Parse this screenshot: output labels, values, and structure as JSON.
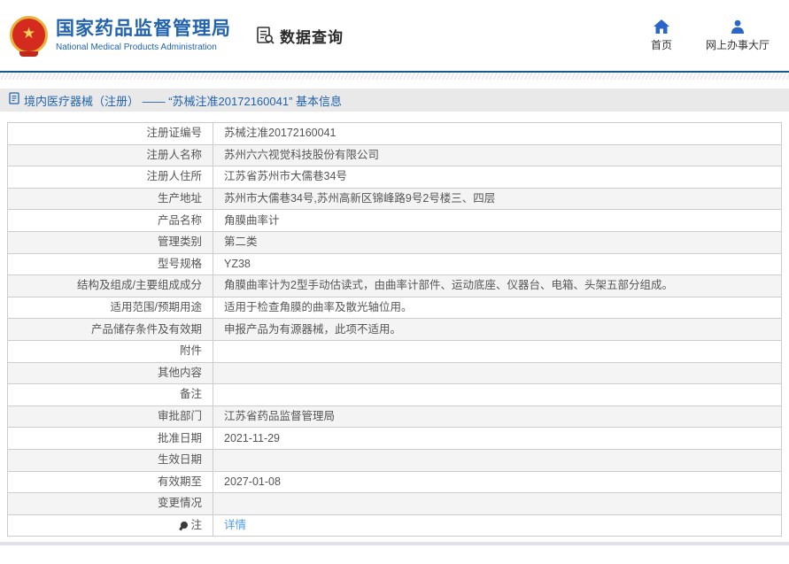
{
  "header": {
    "logo_title": "国家药品监督管理局",
    "logo_subtitle": "National Medical Products Administration",
    "section_label": "数据查询",
    "nav": [
      {
        "label": "首页"
      },
      {
        "label": "网上办事大厅"
      }
    ]
  },
  "breadcrumb": {
    "text": "境内医疗器械（注册） —— “苏械注准20172160041” 基本信息"
  },
  "table": {
    "rows": [
      {
        "label": "注册证编号",
        "value": "苏械注准20172160041"
      },
      {
        "label": "注册人名称",
        "value": "苏州六六视觉科技股份有限公司"
      },
      {
        "label": "注册人住所",
        "value": "江苏省苏州市大儒巷34号"
      },
      {
        "label": "生产地址",
        "value": "苏州市大儒巷34号,苏州高新区锦峰路9号2号楼三、四层"
      },
      {
        "label": "产品名称",
        "value": "角膜曲率计"
      },
      {
        "label": "管理类别",
        "value": "第二类"
      },
      {
        "label": "型号规格",
        "value": "YZ38"
      },
      {
        "label": "结构及组成/主要组成成分",
        "value": "角膜曲率计为2型手动估读式，由曲率计部件、运动底座、仪器台、电箱、头架五部分组成。"
      },
      {
        "label": "适用范围/预期用途",
        "value": "适用于检查角膜的曲率及散光轴位用。"
      },
      {
        "label": "产品储存条件及有效期",
        "value": "申报产品为有源器械，此项不适用。"
      },
      {
        "label": "附件",
        "value": ""
      },
      {
        "label": "其他内容",
        "value": ""
      },
      {
        "label": "备注",
        "value": ""
      },
      {
        "label": "审批部门",
        "value": "江苏省药品监督管理局"
      },
      {
        "label": "批准日期",
        "value": "2021-11-29"
      },
      {
        "label": "生效日期",
        "value": ""
      },
      {
        "label": "有效期至",
        "value": "2027-01-08"
      },
      {
        "label": "变更情况",
        "value": ""
      },
      {
        "label": "注",
        "value": "详情",
        "link": true,
        "icon": "bulb"
      }
    ]
  },
  "icons": {
    "logo": "national-emblem",
    "data_query": "document-search-icon",
    "home": "home-icon",
    "service_hall": "person-icon",
    "breadcrumb": "document-icon",
    "note": "bulb-icon"
  },
  "colors": {
    "brand_blue": "#2263ae",
    "nav_icon_blue": "#2a65c8",
    "link_blue": "#4c9be8",
    "emblem_red": "#d42b1e",
    "emblem_gold": "#e8b33a",
    "bar_gray": "#e9e9e9",
    "row_alt_gray": "#f4f4f4",
    "separator_blue": "#17598f"
  }
}
